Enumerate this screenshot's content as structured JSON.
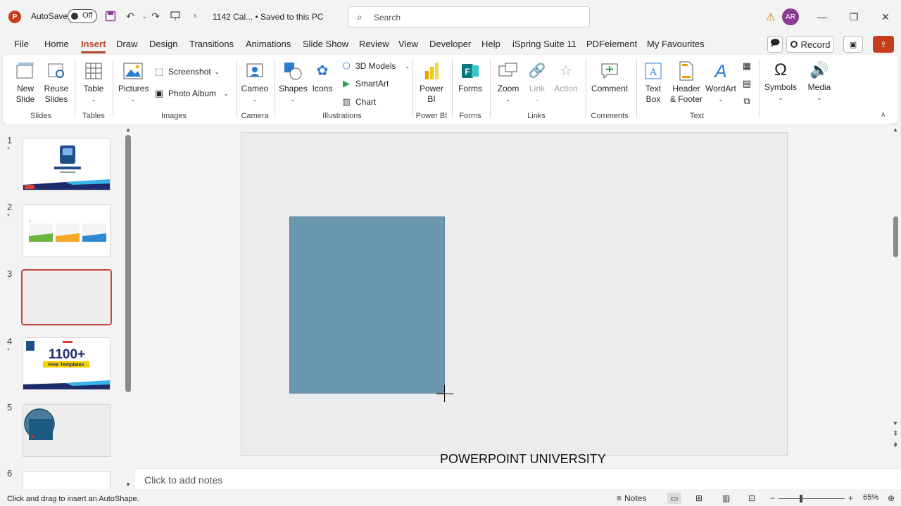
{
  "titlebar": {
    "app_logo": "P",
    "autosave_label": "AutoSave",
    "autosave_state": "Off",
    "doc_title": "1142 Cal... • Saved to this PC",
    "search_placeholder": "Search",
    "avatar_initials": "AR"
  },
  "menu": {
    "tabs": [
      "File",
      "Home",
      "Insert",
      "Draw",
      "Design",
      "Transitions",
      "Animations",
      "Slide Show",
      "Review",
      "View",
      "Developer",
      "Help",
      "iSpring Suite 11",
      "PDFelement",
      "My Favourites"
    ],
    "active_tab": "Insert",
    "record_label": "Record"
  },
  "ribbon": {
    "new_slide": "New\nSlide",
    "reuse_slides": "Reuse\nSlides",
    "grp_slides": "Slides",
    "table": "Table",
    "grp_tables": "Tables",
    "pictures": "Pictures",
    "screenshot": "Screenshot",
    "photo_album": "Photo Album",
    "grp_images": "Images",
    "cameo": "Cameo",
    "grp_camera": "Camera",
    "shapes": "Shapes",
    "icons": "Icons",
    "models_3d": "3D Models",
    "smartart": "SmartArt",
    "chart": "Chart",
    "grp_illustrations": "Illustrations",
    "power_bi": "Power\nBI",
    "grp_power_bi": "Power BI",
    "forms": "Forms",
    "grp_forms": "Forms",
    "zoom": "Zoom",
    "link": "Link",
    "action": "Action",
    "grp_links": "Links",
    "comment": "Comment",
    "grp_comments": "Comments",
    "text_box": "Text\nBox",
    "header_footer": "Header\n& Footer",
    "wordart": "WordArt",
    "grp_text": "Text",
    "symbols": "Symbols",
    "media": "Media"
  },
  "thumbnails": [
    {
      "num": "1",
      "star": "*"
    },
    {
      "num": "2",
      "star": "*"
    },
    {
      "num": "3",
      "star": ""
    },
    {
      "num": "4",
      "star": "*"
    },
    {
      "num": "5",
      "star": ""
    },
    {
      "num": "6",
      "star": ""
    }
  ],
  "thumb4": {
    "big": "1100+",
    "small": "Free Templates"
  },
  "slide": {
    "footer_text": "POWERPOINT UNIVERSITY",
    "shape_color": "#6b98ae"
  },
  "notes": {
    "placeholder": "Click to add notes"
  },
  "status": {
    "message": "Click and drag to insert an AutoShape.",
    "notes_label": "Notes",
    "zoom_level": "65%"
  }
}
